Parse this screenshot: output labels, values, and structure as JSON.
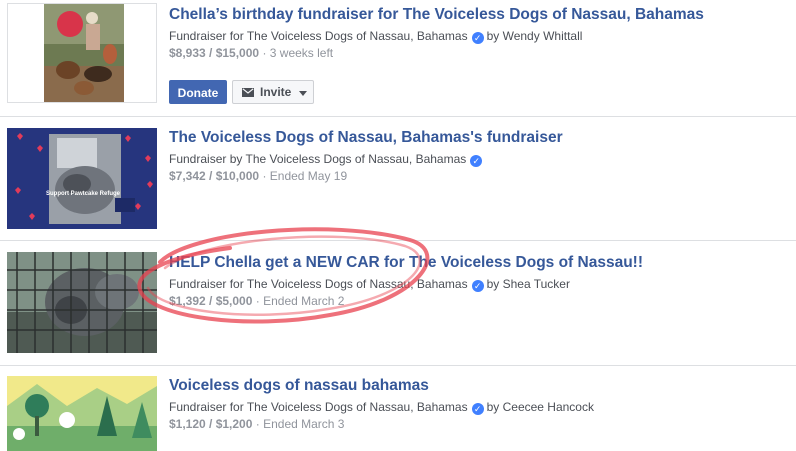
{
  "fundraisers": [
    {
      "title": "Chella’s birthday fundraiser for The Voiceless Dogs of Nassau, Bahamas",
      "subtitle_prefix": "Fundraiser for The Voiceless Dogs of Nassau, Bahamas",
      "by_text": "by Wendy Whittall",
      "amount": "$8,933 / $15,000",
      "status": "· 3 weeks left"
    },
    {
      "title": "The Voiceless Dogs of Nassau, Bahamas's fundraiser",
      "subtitle_prefix": "Fundraiser by The Voiceless Dogs of Nassau, Bahamas",
      "by_text": "",
      "amount": "$7,342 / $10,000",
      "status": "· Ended May 19",
      "thumb_text": "Support Pawtcake Refuge"
    },
    {
      "title": "HELP Chella get a NEW CAR for The Voiceless Dogs of Nassau!!",
      "subtitle_prefix": "Fundraiser for The Voiceless Dogs of Nassau, Bahamas",
      "by_text": "by Shea Tucker",
      "amount": "$1,392 / $5,000",
      "status": "· Ended March 2"
    },
    {
      "title": "Voiceless dogs of nassau bahamas",
      "subtitle_prefix": "Fundraiser for The Voiceless Dogs of Nassau, Bahamas",
      "by_text": "by Ceecee Hancock",
      "amount": "$1,120 / $1,200",
      "status": "· Ended March 3"
    }
  ],
  "buttons": {
    "donate": "Donate",
    "invite": "Invite"
  },
  "colors": {
    "link": "#365899",
    "donate_bg": "#4267b2",
    "verified": "#4080ff",
    "highlight_circle": "#e8424f",
    "meta_text": "#90949c"
  },
  "icons": [
    "verified-badge-icon",
    "envelope-icon",
    "caret-down-icon"
  ]
}
